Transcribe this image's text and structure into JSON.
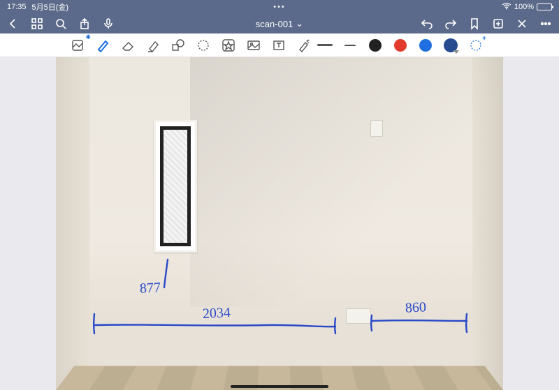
{
  "status": {
    "time": "17:35",
    "date": "5月5日(金)",
    "center_ellipsis": "•••",
    "battery_pct": "100%",
    "battery_fill": 100
  },
  "titlebar": {
    "doc_title": "scan-001",
    "chevron": "⌄"
  },
  "tools": {
    "names": {
      "lasso_photo": "image-select",
      "pen": "pen",
      "eraser": "eraser",
      "highlighter": "highlighter",
      "shapes": "shapes",
      "lasso": "lasso",
      "star_stamp": "favorites",
      "insert_image": "image",
      "text": "text",
      "pointer": "laser-pointer"
    }
  },
  "stroke": {
    "current": "medium"
  },
  "colors": {
    "black": "#222222",
    "red": "#e23b2e",
    "blue": "#1f6fe0",
    "navy": "#264b8f"
  },
  "annotations": {
    "window_gap": "877",
    "span_left": "2034",
    "span_right": "860"
  }
}
